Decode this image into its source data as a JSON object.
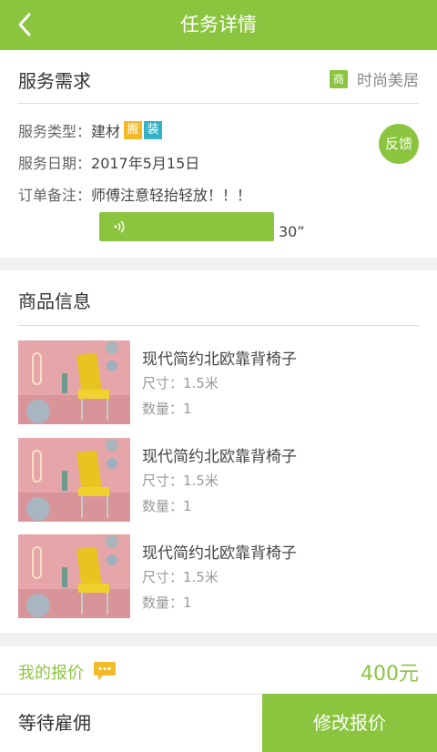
{
  "header": {
    "title": "任务详情"
  },
  "requirement": {
    "section_title": "服务需求",
    "merchant_tag": "商",
    "merchant_name": "时尚美居",
    "service_type_label": "服务类型：",
    "service_type_value": "建材",
    "service_tags": [
      "搬",
      "装"
    ],
    "service_date_label": "服务日期：",
    "service_date_value": "2017年5月15日",
    "order_note_label": "订单备注：",
    "order_note_value": "师傅注意轻抬轻放！！！",
    "voice_duration": "30”",
    "feedback_label": "反馈"
  },
  "goods": {
    "section_title": "商品信息",
    "items": [
      {
        "name": "现代简约北欧靠背椅子",
        "size": "尺寸：1.5米",
        "qty": "数量：1"
      },
      {
        "name": "现代简约北欧靠背椅子",
        "size": "尺寸：1.5米",
        "qty": "数量：1"
      },
      {
        "name": "现代简约北欧靠背椅子",
        "size": "尺寸：1.5米",
        "qty": "数量：1"
      }
    ]
  },
  "quote": {
    "label": "我的报价",
    "price": "400元"
  },
  "footer": {
    "status": "等待雇佣",
    "modify_label": "修改报价"
  },
  "colors": {
    "accent": "#8bc53f",
    "tag_orange": "#f2b928",
    "tag_teal": "#35b2c6"
  }
}
